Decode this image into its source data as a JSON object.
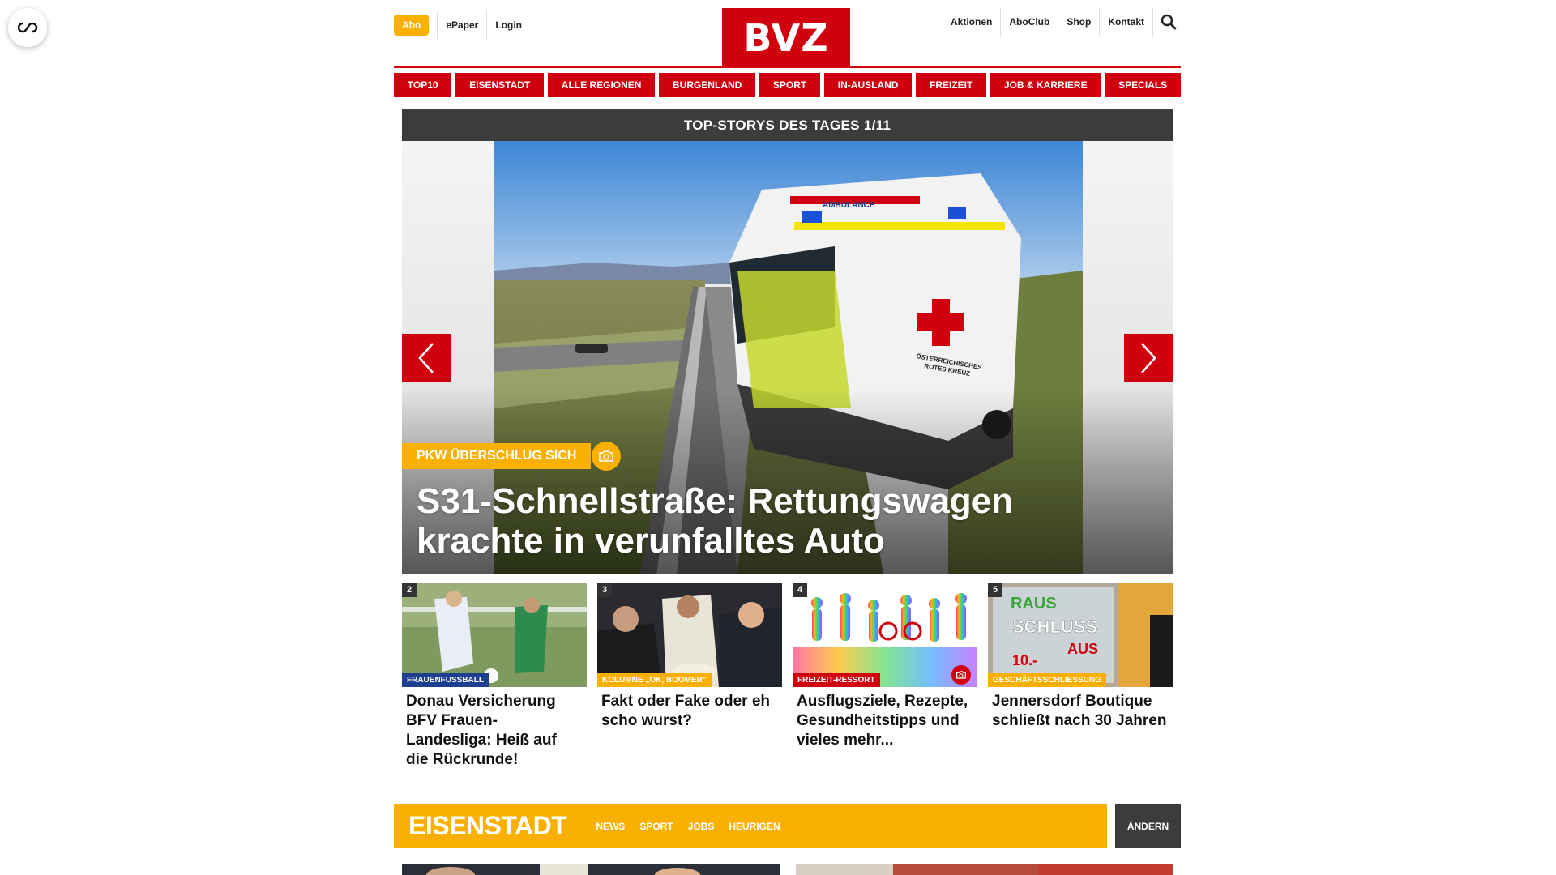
{
  "header": {
    "abo_label": "Abo",
    "links_left": [
      "ePaper",
      "Login"
    ],
    "logo_text": "BVZ",
    "links_right": [
      "Aktionen",
      "AboClub",
      "Shop",
      "Kontakt"
    ]
  },
  "nav": {
    "items": [
      "TOP10",
      "EISENSTADT",
      "ALLE REGIONEN",
      "BURGENLAND",
      "SPORT",
      "IN-AUSLAND",
      "FREIZEIT",
      "JOB & KARRIERE",
      "SPECIALS"
    ]
  },
  "top_stories": {
    "heading": "TOP-STORYS DES TAGES 1/11",
    "hero": {
      "tag": "PKW ÜBERSCHLUG SICH",
      "title": "S31-Schnellstraße: Rettungswagen krachte in verunfalltes Auto",
      "image_text": {
        "ambulance": "AMBULANCE",
        "cross_line1": "ÖSTERREICHISCHES",
        "cross_line2": "ROTES KREUZ"
      }
    },
    "cards": [
      {
        "num": "2",
        "category": "FRAUENFUSSBALL",
        "title": "Donau Versicherung BFV Frauen-Landesliga: Heiß auf die Rückrunde!"
      },
      {
        "num": "3",
        "category": "KOLUMNE „OK, BOOMER\"",
        "title": "Fakt oder Fake oder eh scho wurst?"
      },
      {
        "num": "4",
        "category": "FREIZEIT-RESSORT",
        "title": "Ausflugsziele, Rezepte, Gesundheitstipps und vieles mehr..."
      },
      {
        "num": "5",
        "category": "GESCHÄFTSSCHLIESSUNG",
        "title": "Jennersdorf Boutique schließt nach 30 Jahren",
        "image_text": {
          "line1": "RAUS",
          "line2": "SCHLUSS",
          "line3": "10.-",
          "line4": "AUS"
        }
      }
    ]
  },
  "region": {
    "title": "EISENSTADT",
    "links": [
      "NEWS",
      "SPORT",
      "JOBS",
      "HEURIGEN"
    ],
    "change_label": "ÄNDERN"
  },
  "colors": {
    "brand_red": "#d1000e",
    "accent_yellow": "#f9b000",
    "dark_gray": "#3c3c3c",
    "category_blue": "#1f3f8f"
  }
}
